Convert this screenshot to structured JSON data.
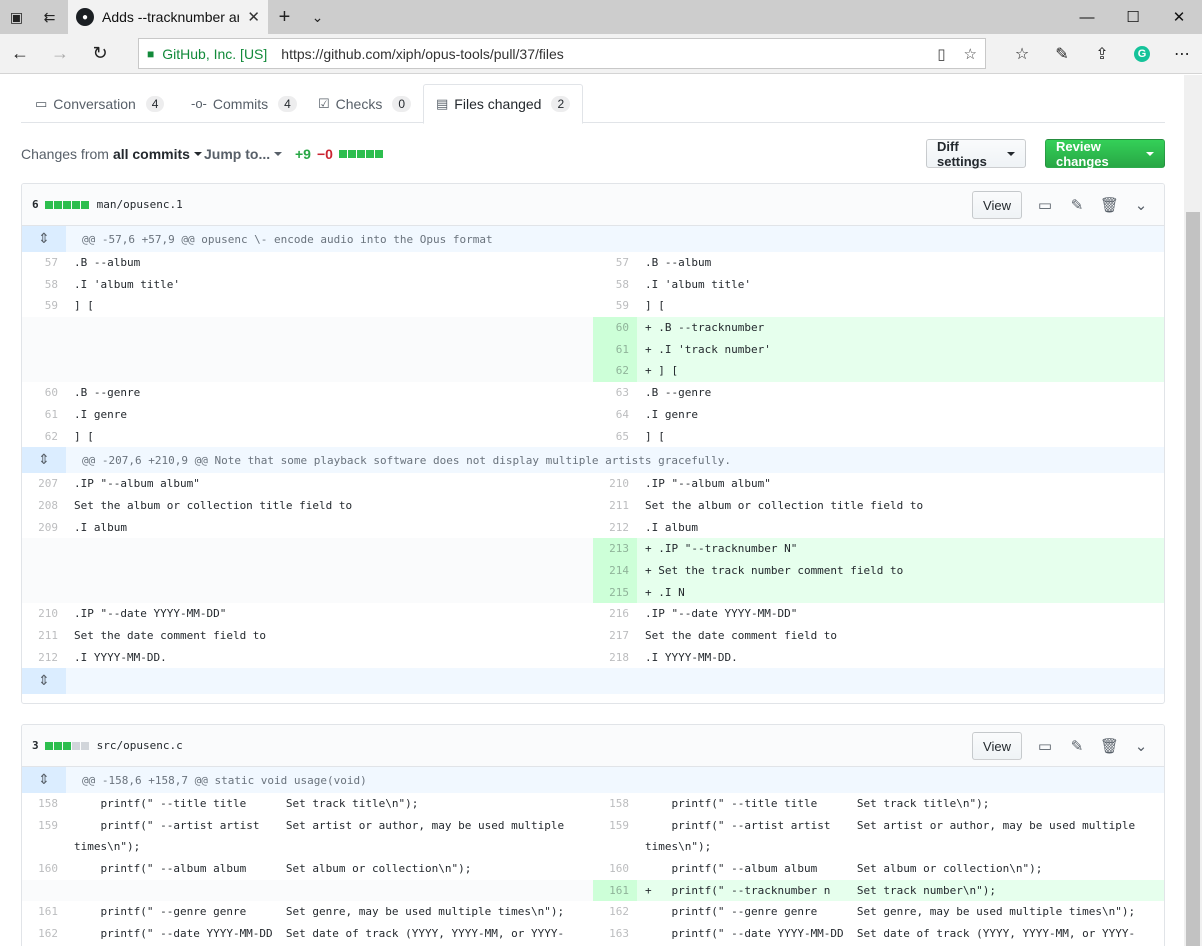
{
  "browser": {
    "tab_title": "Adds --tracknumber arg",
    "site_identity": "GitHub, Inc. [US]",
    "url": "https://github.com/xiph/opus-tools/pull/37/files"
  },
  "pr_tabs": [
    {
      "label": "Conversation",
      "count": "4"
    },
    {
      "label": "Commits",
      "count": "4"
    },
    {
      "label": "Checks",
      "count": "0"
    },
    {
      "label": "Files changed",
      "count": "2"
    }
  ],
  "toolbar": {
    "changes_from_prefix": "Changes from",
    "changes_from_value": "all commits",
    "jump_to": "Jump to...",
    "additions": "+9",
    "deletions": "−0",
    "diff_settings": "Diff settings",
    "review_changes": "Review changes"
  },
  "files": [
    {
      "count": "6",
      "path": "man/opusenc.1",
      "view_label": "View",
      "hunks": [
        "@@ -57,6 +57,9 @@ opusenc \\- encode audio into the Opus format",
        "@@ -207,6 +210,9 @@ Note that some playback software does not display multiple artists gracefully."
      ],
      "rows": [
        {
          "l": "57",
          "lc": ".B --album",
          "r": "57",
          "rc": ".B --album"
        },
        {
          "l": "58",
          "lc": ".I 'album title'",
          "r": "58",
          "rc": ".I 'album title'"
        },
        {
          "l": "59",
          "lc": "] [",
          "r": "59",
          "rc": "] ["
        },
        {
          "l": "",
          "lc": "",
          "r": "60",
          "rc": "+ .B --tracknumber"
        },
        {
          "l": "",
          "lc": "",
          "r": "61",
          "rc": "+ .I 'track number'"
        },
        {
          "l": "",
          "lc": "",
          "r": "62",
          "rc": "+ ] ["
        },
        {
          "l": "60",
          "lc": ".B --genre",
          "r": "63",
          "rc": ".B --genre"
        },
        {
          "l": "61",
          "lc": ".I genre",
          "r": "64",
          "rc": ".I genre"
        },
        {
          "l": "62",
          "lc": "] [",
          "r": "65",
          "rc": "] ["
        },
        {
          "l": "207",
          "lc": ".IP \"--album album\"",
          "r": "210",
          "rc": ".IP \"--album album\""
        },
        {
          "l": "208",
          "lc": "Set the album or collection title field to",
          "r": "211",
          "rc": "Set the album or collection title field to"
        },
        {
          "l": "209",
          "lc": ".I album",
          "r": "212",
          "rc": ".I album"
        },
        {
          "l": "",
          "lc": "",
          "r": "213",
          "rc": "+ .IP \"--tracknumber N\""
        },
        {
          "l": "",
          "lc": "",
          "r": "214",
          "rc": "+ Set the track number comment field to"
        },
        {
          "l": "",
          "lc": "",
          "r": "215",
          "rc": "+ .I N"
        },
        {
          "l": "210",
          "lc": ".IP \"--date YYYY-MM-DD\"",
          "r": "216",
          "rc": ".IP \"--date YYYY-MM-DD\""
        },
        {
          "l": "211",
          "lc": "Set the date comment field to",
          "r": "217",
          "rc": "Set the date comment field to"
        },
        {
          "l": "212",
          "lc": ".I YYYY-MM-DD.",
          "r": "218",
          "rc": ".I YYYY-MM-DD."
        }
      ]
    },
    {
      "count": "3",
      "path": "src/opusenc.c",
      "view_label": "View",
      "hunks": [
        "@@ -158,6 +158,7 @@ static void usage(void)"
      ],
      "rows": [
        {
          "l": "158",
          "lc": "    printf(\" --title title      Set track title\\n\");",
          "r": "158",
          "rc": "    printf(\" --title title      Set track title\\n\");"
        },
        {
          "l": "159",
          "lc": "    printf(\" --artist artist    Set artist or author, may be used multiple times\\n\");",
          "r": "159",
          "rc": "    printf(\" --artist artist    Set artist or author, may be used multiple times\\n\");"
        },
        {
          "l": "160",
          "lc": "    printf(\" --album album      Set album or collection\\n\");",
          "r": "160",
          "rc": "    printf(\" --album album      Set album or collection\\n\");"
        },
        {
          "l": "",
          "lc": "",
          "r": "161",
          "rc": "+   printf(\" --tracknumber n    Set track number\\n\");"
        },
        {
          "l": "161",
          "lc": "    printf(\" --genre genre      Set genre, may be used multiple times\\n\");",
          "r": "162",
          "rc": "    printf(\" --genre genre      Set genre, may be used multiple times\\n\");"
        },
        {
          "l": "162",
          "lc": "    printf(\" --date YYYY-MM-DD  Set date of track (YYYY, YYYY-MM, or YYYY-",
          "r": "163",
          "rc": "    printf(\" --date YYYY-MM-DD  Set date of track (YYYY, YYYY-MM, or YYYY-"
        }
      ]
    }
  ]
}
